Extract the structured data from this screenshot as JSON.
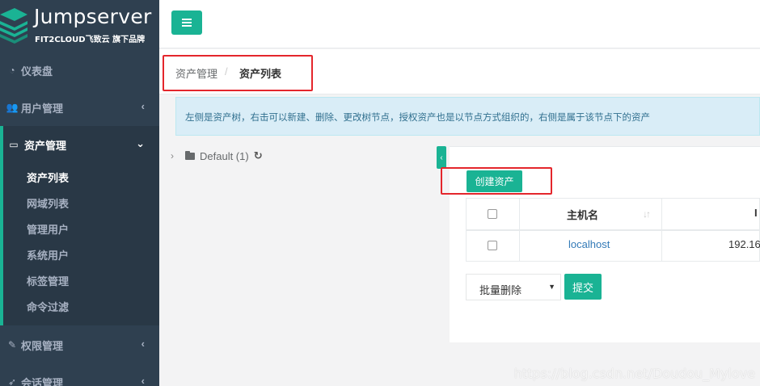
{
  "app": {
    "logo_title": "Jumpserver",
    "logo_subtitle": "FIT2CLOUD飞致云 旗下品牌"
  },
  "sidebar": {
    "items": [
      {
        "label": "仪表盘",
        "icon": "dashboard-icon"
      },
      {
        "label": "用户管理",
        "icon": "users-icon"
      },
      {
        "label": "资产管理",
        "icon": "inbox-icon"
      },
      {
        "label": "权限管理",
        "icon": "edit-icon"
      },
      {
        "label": "会话管理",
        "icon": "rocket-icon"
      }
    ],
    "sub_items": [
      "资产列表",
      "网域列表",
      "管理用户",
      "系统用户",
      "标签管理",
      "命令过滤"
    ]
  },
  "breadcrumb": {
    "parent": "资产管理",
    "separator": "/",
    "current": "资产列表"
  },
  "alert": {
    "text": "左侧是资产树，右击可以新建、删除、更改树节点，授权资产也是以节点方式组织的，右侧是属于该节点下的资产"
  },
  "tree": {
    "node_label": "Default (1)"
  },
  "toolbar": {
    "create_label": "创建资产"
  },
  "table": {
    "headers": [
      "",
      "主机名",
      "I"
    ],
    "rows": [
      {
        "hostname": "localhost",
        "ip": "192.16"
      }
    ]
  },
  "bulk": {
    "select_value": "批量删除",
    "submit_label": "提交"
  },
  "watermark": "https://blog.csdn.net/Doudou_Mylove",
  "colors": {
    "accent": "#1ab394",
    "sidebar": "#2f4050",
    "highlight": "#e4262c"
  }
}
